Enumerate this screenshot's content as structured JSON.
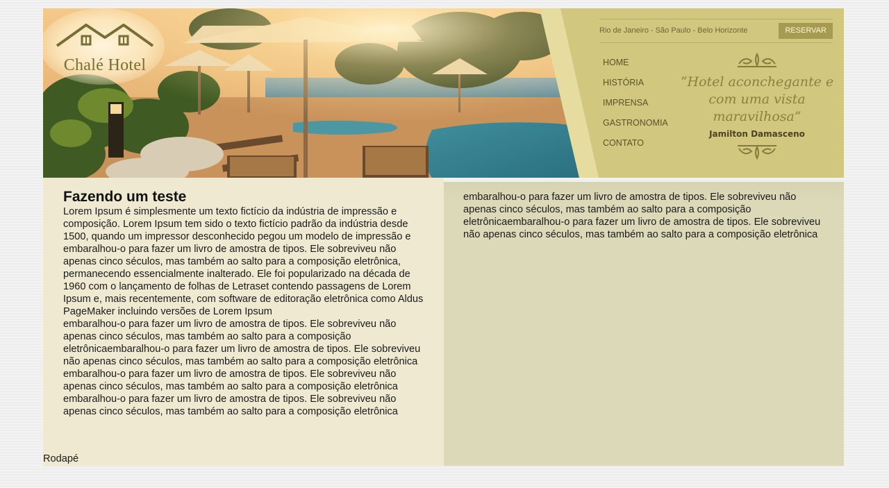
{
  "header": {
    "logo_text": "Chalé Hotel",
    "cities": "Rio de Janeiro - São Paulo - Belo Horizonte",
    "reserve_label": "RESERVAR",
    "nav": [
      "HOME",
      "HISTÓRIA",
      "IMPRENSA",
      "GASTRONOMIA",
      "CONTATO"
    ],
    "quote": "“Hotel aconchegante e com uma vista maravilhosa”",
    "quote_author": "Jamilton Damasceno"
  },
  "main": {
    "title": "Fazendo um teste",
    "paragraphs": [
      "Lorem Ipsum é simplesmente um texto fictício da indústria de impressão e composição. Lorem Ipsum tem sido o texto fictício padrão da indústria desde 1500, quando um impressor desconhecido pegou um modelo de impressão e embaralhou-o para fazer um livro de amostra de tipos. Ele sobreviveu não apenas cinco séculos, mas também ao salto para a composição eletrônica, permanecendo essencialmente inalterado. Ele foi popularizado na década de 1960 com o lançamento de folhas de Letraset contendo passagens de Lorem Ipsum e, mais recentemente, com software de editoração eletrônica como Aldus PageMaker incluindo versões de Lorem Ipsum",
      "embaralhou-o para fazer um livro de amostra de tipos. Ele sobreviveu não apenas cinco séculos, mas também ao salto para a composição eletrônicaembaralhou-o para fazer um livro de amostra de tipos. Ele sobreviveu não apenas cinco séculos, mas também ao salto para a composição eletrônica",
      "embaralhou-o para fazer um livro de amostra de tipos. Ele sobreviveu não apenas cinco séculos, mas também ao salto para a composição eletrônica embaralhou-o para fazer um livro de amostra de tipos. Ele sobreviveu não apenas cinco séculos, mas também ao salto para a composição eletrônica"
    ]
  },
  "aside": {
    "text": "embaralhou-o para fazer um livro de amostra de tipos. Ele sobreviveu não apenas cinco séculos, mas também ao salto para a composição eletrônicaembaralhou-o para fazer um livro de amostra de tipos. Ele sobreviveu não apenas cinco séculos, mas também ao salto para a composição eletrônica"
  },
  "footer": {
    "text": "Rodapé"
  },
  "colors": {
    "header_bg": "#d2c77f",
    "main_bg": "#eee9d0",
    "aside_bg": "#dcd9b9",
    "accent": "#a79b52"
  }
}
